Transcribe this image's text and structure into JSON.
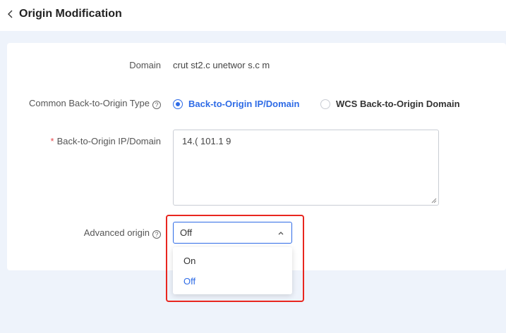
{
  "header": {
    "back_icon": "chevron-left-icon",
    "title": "Origin Modification"
  },
  "form": {
    "domain": {
      "label": "Domain",
      "value": "crut  st2.c  unetwor  s.c  m"
    },
    "origin_type": {
      "label": "Common Back-to-Origin Type",
      "help_icon": "question-circle-icon",
      "options": [
        {
          "label": "Back-to-Origin IP/Domain",
          "checked": true
        },
        {
          "label": "WCS Back-to-Origin Domain",
          "checked": false
        }
      ]
    },
    "origin_ip": {
      "required_mark": "*",
      "label": "Back-to-Origin IP/Domain",
      "value": "14.(   101.1  9"
    },
    "advanced_origin": {
      "label": "Advanced origin",
      "help_icon": "question-circle-icon",
      "selected": "Off",
      "options": [
        {
          "label": "On",
          "selected": false
        },
        {
          "label": "Off",
          "selected": true
        }
      ]
    }
  },
  "colors": {
    "accent": "#2e6be6",
    "highlight": "#e8261f",
    "background": "#eef3fb"
  }
}
